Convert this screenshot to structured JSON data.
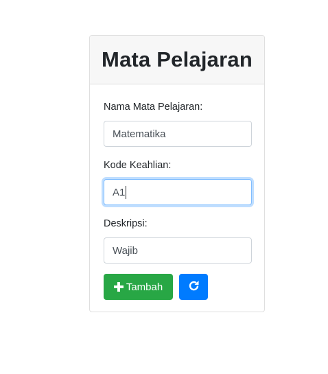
{
  "card": {
    "title": "Mata Pelajaran"
  },
  "form": {
    "nama": {
      "label": "Nama Mata Pelajaran:",
      "value": "Matematika"
    },
    "kode": {
      "label": "Kode Keahlian:",
      "value": "A1"
    },
    "deskripsi": {
      "label": "Deskripsi:",
      "value": "Wajib"
    }
  },
  "buttons": {
    "add_label": "Tambah",
    "add_icon": "plus-icon",
    "refresh_icon": "refresh-icon",
    "add_color": "#28a745",
    "refresh_color": "#007bff"
  }
}
